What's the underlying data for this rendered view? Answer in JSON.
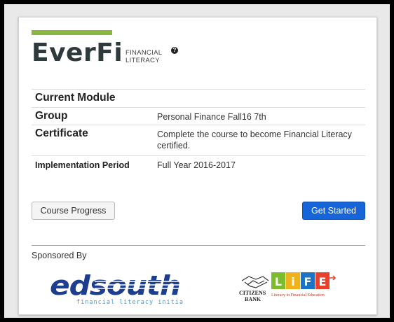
{
  "brand": {
    "name": "EverFi",
    "sub_line1": "FINANCIAL",
    "sub_line2": "LITERACY",
    "help_glyph": "?",
    "accent_color": "#8ab53f"
  },
  "info_rows": [
    {
      "label": "Current Module",
      "value": ""
    },
    {
      "label": "Group",
      "value": "Personal Finance Fall16 7th"
    },
    {
      "label": "Certificate",
      "value": "Complete the course to become Financial Literacy certified."
    },
    {
      "label": "Implementation Period",
      "value": "Full Year 2016-2017"
    }
  ],
  "buttons": {
    "course_progress": "Course Progress",
    "get_started": "Get Started",
    "primary_color": "#1565d8"
  },
  "sponsors": {
    "heading": "Sponsored By",
    "edsouth": {
      "wordmark": "edsouth",
      "tagline": "financial literacy initiative"
    },
    "citizens": {
      "bank_line1": "CITIZENS",
      "bank_line2": "BANK",
      "life_letters": [
        "L",
        "i",
        "F",
        "E"
      ],
      "life_tagline": "Literacy in Financial Education"
    }
  }
}
